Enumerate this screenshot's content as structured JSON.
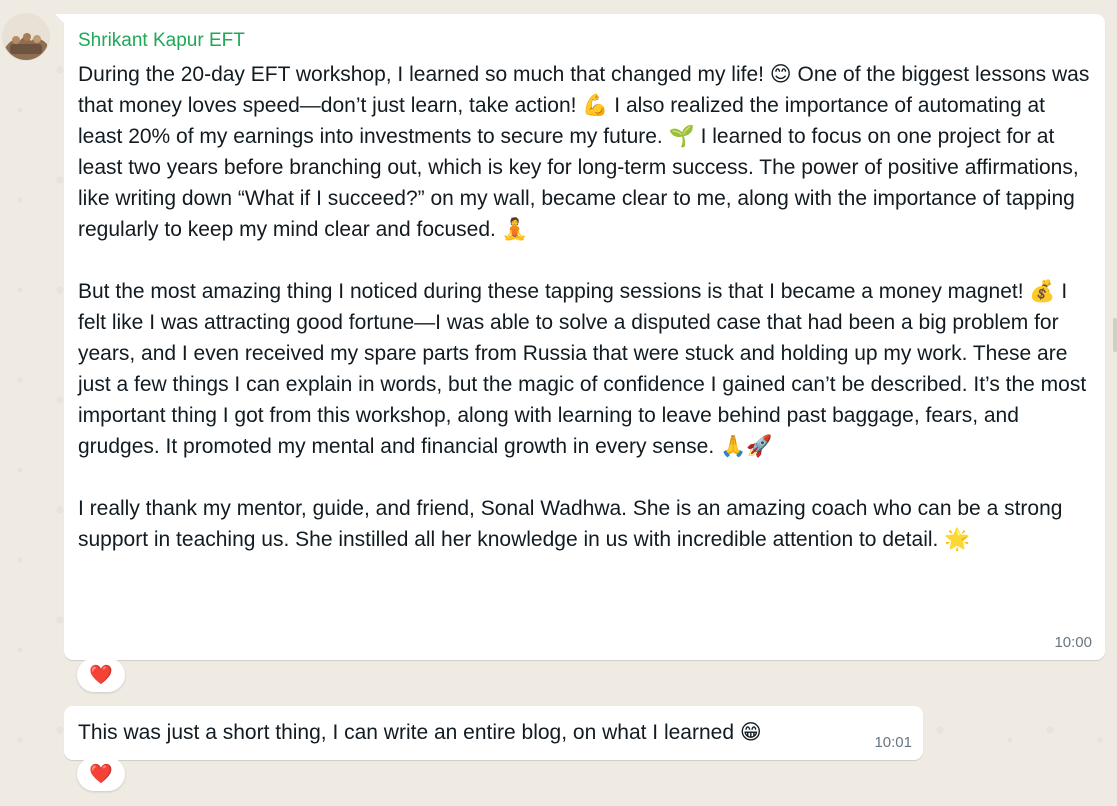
{
  "chat": {
    "messages": [
      {
        "sender": "Shrikant Kapur EFT",
        "paragraphs": [
          "During the 20-day EFT workshop, I learned so much that changed my life! 😊 One of the biggest lessons was that money loves speed—don’t just learn, take action! 💪 I also realized the importance of automating at least 20% of my earnings into investments to secure my future. 🌱 I learned to focus on one project for at least two years before branching out, which is key for long-term success. The power of positive affirmations, like writing down “What if I succeed?” on my wall, became clear to me, along with the importance of tapping regularly to keep my mind clear and focused. 🧘",
          "But the most amazing thing I noticed during these tapping sessions is that I became a money magnet! 💰 I felt like I was attracting good fortune—I was able to solve a disputed case that had been a big problem for years, and I even received my spare parts from Russia that were stuck and holding up my work. These are just a few things I can explain in words, but the magic of confidence I gained can’t be described. It’s the most important thing I got from this workshop, along with learning to leave behind past baggage, fears, and grudges. It promoted my mental and financial growth in every sense. 🙏🚀",
          "I really thank my mentor, guide, and friend, Sonal Wadhwa. She is an amazing coach who can be a strong support in teaching us. She instilled all her knowledge in us with incredible attention to detail. 🌟"
        ],
        "time": "10:00",
        "reaction": "❤️"
      },
      {
        "text": "This was just a short thing, I can write an entire blog, on what I learned 😁",
        "time": "10:01",
        "reaction": "❤️"
      }
    ]
  },
  "colors": {
    "background": "#efeae2",
    "bubble": "#ffffff",
    "sender_name": "#1fa855",
    "timestamp": "#667781",
    "text": "#111b21"
  },
  "icons": {
    "avatar": "profile-photo"
  }
}
